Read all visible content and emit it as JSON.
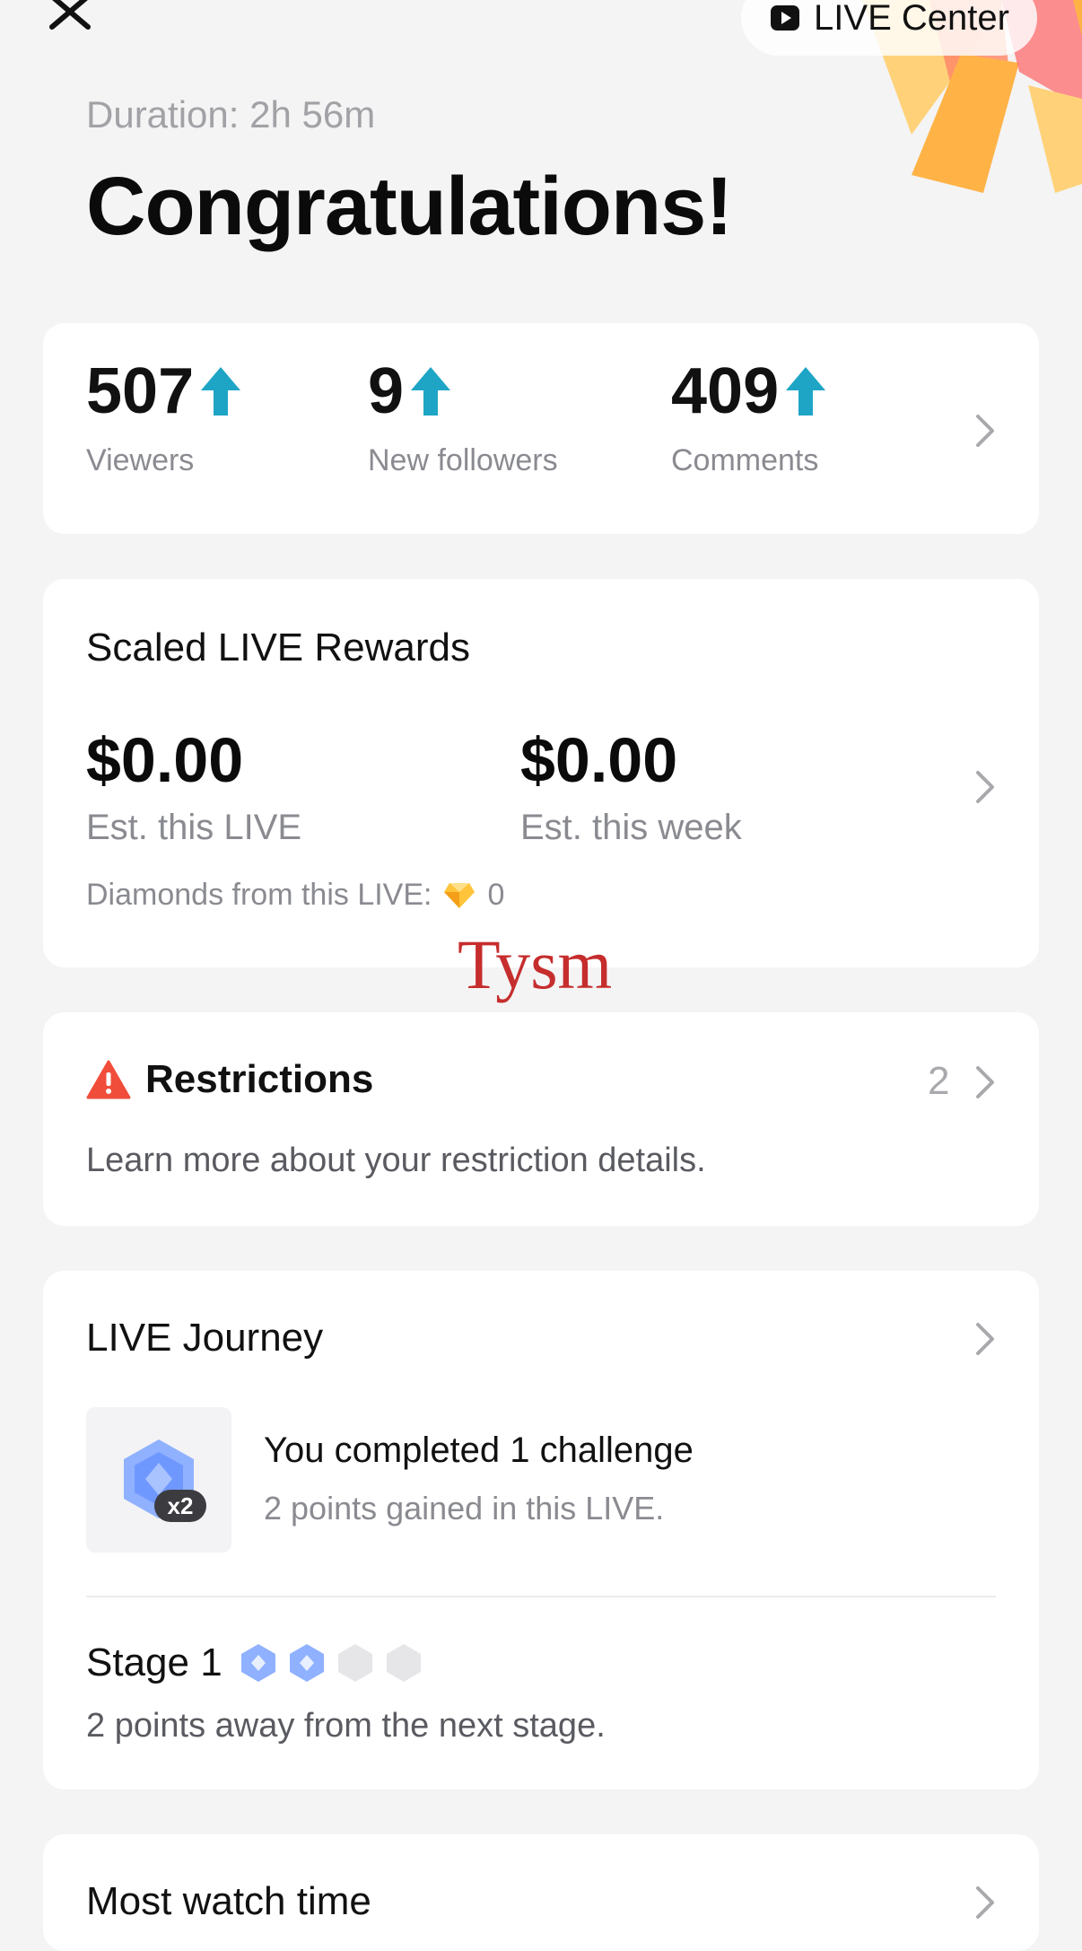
{
  "header": {
    "live_center_label": "LIVE Center",
    "duration": "Duration: 2h 56m",
    "title": "Congratulations!"
  },
  "stats": [
    {
      "value": "507",
      "label": "Viewers"
    },
    {
      "value": "9",
      "label": "New followers"
    },
    {
      "value": "409",
      "label": "Comments"
    }
  ],
  "rewards": {
    "title": "Scaled LIVE Rewards",
    "live_value": "$0.00",
    "live_label": "Est. this LIVE",
    "week_value": "$0.00",
    "week_label": "Est. this week",
    "diamonds_label": "Diamonds from this LIVE:",
    "diamonds_value": "0"
  },
  "overlay_text": "Tysm",
  "restrictions": {
    "title": "Restrictions",
    "count": "2",
    "description": "Learn more about your restriction details."
  },
  "journey": {
    "title": "LIVE Journey",
    "badge_multiplier": "x2",
    "challenge_title": "You completed 1 challenge",
    "challenge_sub": "2 points gained in this LIVE.",
    "stage_label": "Stage 1",
    "stage_progress": {
      "filled": 2,
      "total": 4
    },
    "stage_sub": "2 points away from the next stage."
  },
  "watch_time": {
    "title": "Most watch time"
  },
  "colors": {
    "accent_up_arrow": "#1ea5c6",
    "warning": "#f04d3a",
    "stage_filled": "#7aa7ff",
    "stage_empty": "#e6e6e8"
  }
}
